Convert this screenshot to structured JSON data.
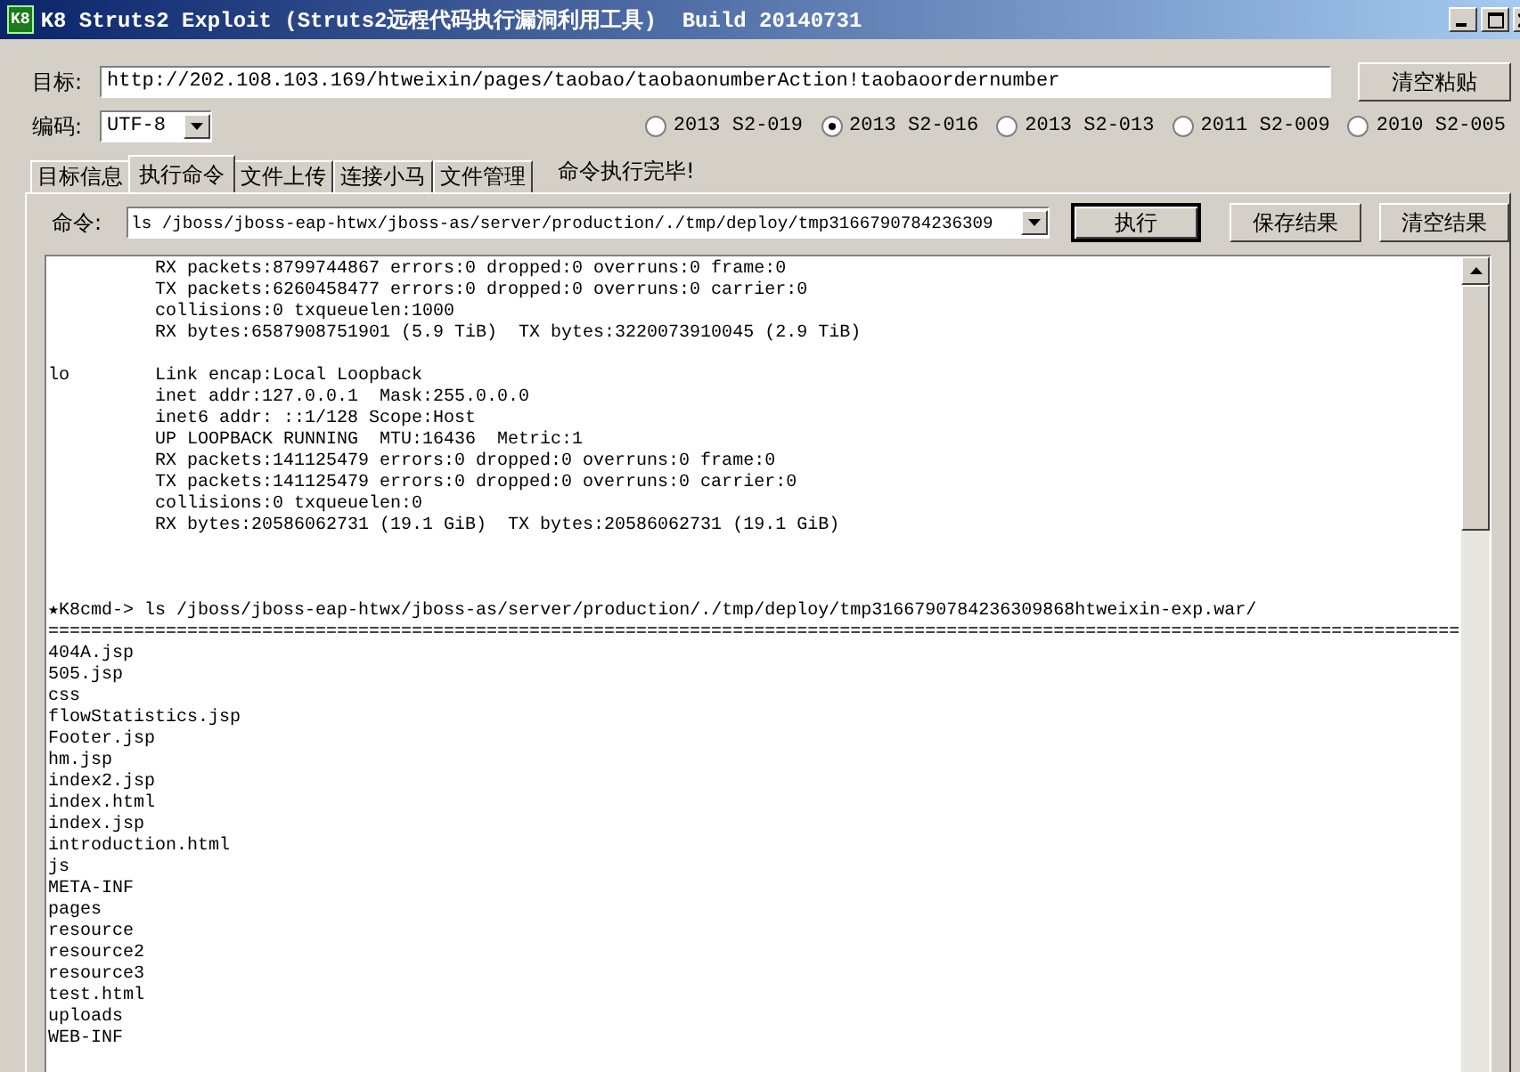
{
  "window": {
    "title": "K8 Struts2 Exploit (Struts2远程代码执行漏洞利用工具)  Build 20140731",
    "icon_text": "K8"
  },
  "target": {
    "label": "目标:",
    "value": "http://202.108.103.169/htweixin/pages/taobao/taobaonumberAction!taobaoordernumber",
    "button": "清空粘贴"
  },
  "encoding": {
    "label": "编码:",
    "value": "UTF-8"
  },
  "exploits": [
    {
      "label": "2013 S2-019",
      "selected": false
    },
    {
      "label": "2013 S2-016",
      "selected": true
    },
    {
      "label": "2013 S2-013",
      "selected": false
    },
    {
      "label": "2011 S2-009",
      "selected": false
    },
    {
      "label": "2010 S2-005",
      "selected": false
    }
  ],
  "tabs": [
    {
      "label": "目标信息",
      "selected": false
    },
    {
      "label": "执行命令",
      "selected": true
    },
    {
      "label": "文件上传",
      "selected": false
    },
    {
      "label": "连接小马",
      "selected": false
    },
    {
      "label": "文件管理",
      "selected": false
    }
  ],
  "status": "命令执行完毕!",
  "command": {
    "label": "命令:",
    "value": "ls /jboss/jboss-eap-htwx/jboss-as/server/production/./tmp/deploy/tmp3166790784236309",
    "buttons": [
      "执行",
      "保存结果",
      "清空结果"
    ]
  },
  "output": [
    {
      "kind": "line",
      "text": "          RX packets:8799744867 errors:0 dropped:0 overruns:0 frame:0"
    },
    {
      "kind": "line",
      "text": "          TX packets:6260458477 errors:0 dropped:0 overruns:0 carrier:0"
    },
    {
      "kind": "line",
      "text": "          collisions:0 txqueuelen:1000"
    },
    {
      "kind": "line",
      "text": "          RX bytes:6587908751901 (5.9 TiB)  TX bytes:3220073910045 (2.9 TiB)"
    },
    {
      "kind": "blank"
    },
    {
      "kind": "line",
      "text": "lo        Link encap:Local Loopback"
    },
    {
      "kind": "line",
      "text": "          inet addr:127.0.0.1  Mask:255.0.0.0"
    },
    {
      "kind": "line",
      "text": "          inet6 addr: ::1/128 Scope:Host"
    },
    {
      "kind": "line",
      "text": "          UP LOOPBACK RUNNING  MTU:16436  Metric:1"
    },
    {
      "kind": "line",
      "text": "          RX packets:141125479 errors:0 dropped:0 overruns:0 frame:0"
    },
    {
      "kind": "line",
      "text": "          TX packets:141125479 errors:0 dropped:0 overruns:0 carrier:0"
    },
    {
      "kind": "line",
      "text": "          collisions:0 txqueuelen:0"
    },
    {
      "kind": "line",
      "text": "          RX bytes:20586062731 (19.1 GiB)  TX bytes:20586062731 (19.1 GiB)"
    },
    {
      "kind": "blank"
    },
    {
      "kind": "blank"
    },
    {
      "kind": "blank"
    },
    {
      "kind": "prompt",
      "text": "★K8cmd-> ls /jboss/jboss-eap-htwx/jboss-as/server/production/./tmp/deploy/tmp3166790784236309868htweixin-exp.war/"
    },
    {
      "kind": "rule",
      "text": "===================================================================================================================================="
    },
    {
      "kind": "line",
      "text": "404A.jsp"
    },
    {
      "kind": "line",
      "text": "505.jsp"
    },
    {
      "kind": "line",
      "text": "css"
    },
    {
      "kind": "line",
      "text": "flowStatistics.jsp"
    },
    {
      "kind": "line",
      "text": "Footer.jsp"
    },
    {
      "kind": "line",
      "text": "hm.jsp"
    },
    {
      "kind": "line",
      "text": "index2.jsp"
    },
    {
      "kind": "line",
      "text": "index.html"
    },
    {
      "kind": "line",
      "text": "index.jsp"
    },
    {
      "kind": "line",
      "text": "introduction.html"
    },
    {
      "kind": "line",
      "text": "js"
    },
    {
      "kind": "line",
      "text": "META-INF"
    },
    {
      "kind": "line",
      "text": "pages"
    },
    {
      "kind": "line",
      "text": "resource"
    },
    {
      "kind": "line",
      "text": "resource2"
    },
    {
      "kind": "line",
      "text": "resource3"
    },
    {
      "kind": "line",
      "text": "test.html"
    },
    {
      "kind": "line",
      "text": "uploads"
    },
    {
      "kind": "line",
      "text": "WEB-INF"
    }
  ]
}
